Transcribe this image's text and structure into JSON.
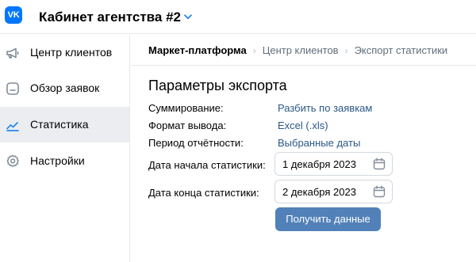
{
  "header": {
    "logo_text": "VK",
    "title": "Кабинет агентства #2"
  },
  "sidebar": {
    "items": [
      {
        "label": "Центр клиентов",
        "icon": "megaphone-icon",
        "active": false
      },
      {
        "label": "Обзор заявок",
        "icon": "document-icon",
        "active": false
      },
      {
        "label": "Статистика",
        "icon": "chart-line-icon",
        "active": true
      },
      {
        "label": "Настройки",
        "icon": "gear-icon",
        "active": false
      }
    ]
  },
  "breadcrumb": [
    "Маркет-платформа",
    "Центр клиентов",
    "Экспорт статистики"
  ],
  "main": {
    "heading": "Параметры экспорта",
    "rows": [
      {
        "label": "Суммирование:",
        "value": "Разбить по заявкам"
      },
      {
        "label": "Формат вывода:",
        "value": "Excel (.xls)"
      },
      {
        "label": "Период отчётности:",
        "value": "Выбранные даты"
      }
    ],
    "start_date": {
      "label": "Дата начала статистики:",
      "value": "1 декабря 2023"
    },
    "end_date": {
      "label": "Дата конца статистики:",
      "value": "2 декабря 2023"
    },
    "submit_label": "Получить данные"
  },
  "colors": {
    "brand": "#0077ff",
    "link": "#2a5885",
    "button": "#5181b8",
    "active_nav": "#ebedf0",
    "border": "#e7e8ec"
  }
}
